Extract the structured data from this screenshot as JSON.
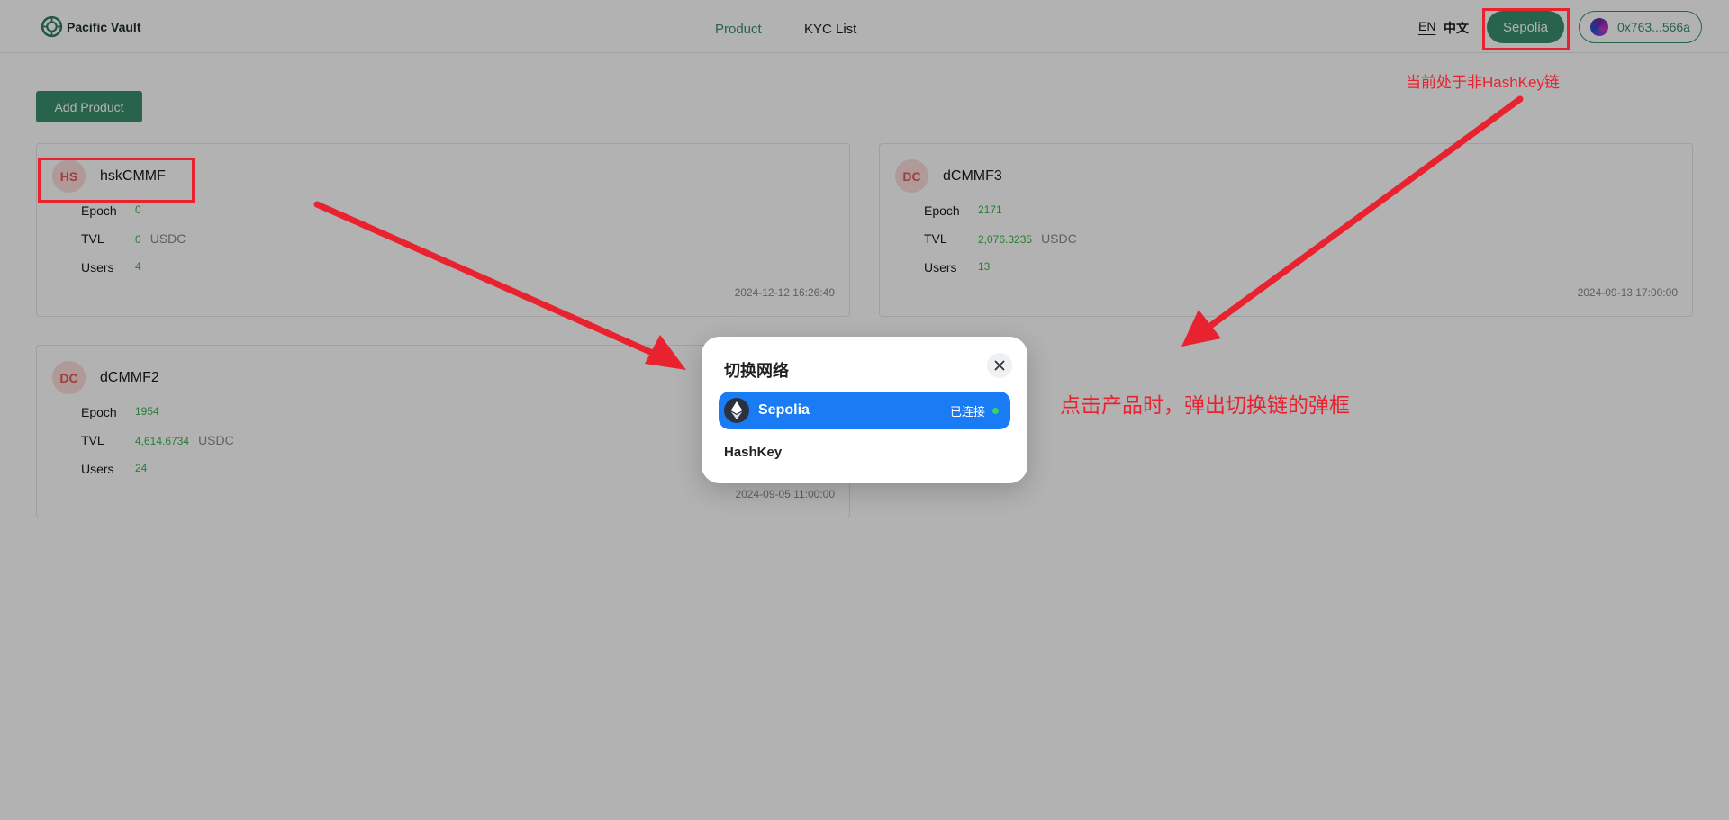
{
  "header": {
    "brand": "Pacific Vault",
    "nav": [
      {
        "label": "Product",
        "active": true
      },
      {
        "label": "KYC List",
        "active": false
      }
    ],
    "languages": [
      "EN",
      "中文"
    ],
    "network_button": "Sepolia",
    "wallet_address": "0x763...566a"
  },
  "main": {
    "add_button": "Add Product",
    "stat_labels": {
      "epoch": "Epoch",
      "tvl": "TVL",
      "users": "Users"
    },
    "products": [
      {
        "avatar": "HS",
        "name": "hskCMMF",
        "epoch": "0",
        "tvl": "0",
        "unit": "USDC",
        "users": "4",
        "date": "2024-12-12 16:26:49"
      },
      {
        "avatar": "DC",
        "name": "dCMMF3",
        "epoch": "2171",
        "tvl": "2,076.3235",
        "unit": "USDC",
        "users": "13",
        "date": "2024-09-13 17:00:00"
      },
      {
        "avatar": "DC",
        "name": "dCMMF2",
        "epoch": "1954",
        "tvl": "4,614.6734",
        "unit": "USDC",
        "users": "24",
        "date": "2024-09-05 11:00:00"
      }
    ]
  },
  "modal": {
    "title": "切换网络",
    "networks": [
      {
        "name": "Sepolia",
        "status": "已连接",
        "selected": true,
        "icon": "ethereum-icon"
      },
      {
        "name": "HashKey",
        "status": "",
        "selected": false
      }
    ]
  },
  "annotations": {
    "note_network": "当前处于非HashKey链",
    "note_modal": "点击产品时，弹出切换链的弹框"
  },
  "colors": {
    "brand_green": "#3a8e6e",
    "value_green": "#3cb34a",
    "selected_blue": "#1a7cf5",
    "annotation_red": "#e8232f"
  }
}
